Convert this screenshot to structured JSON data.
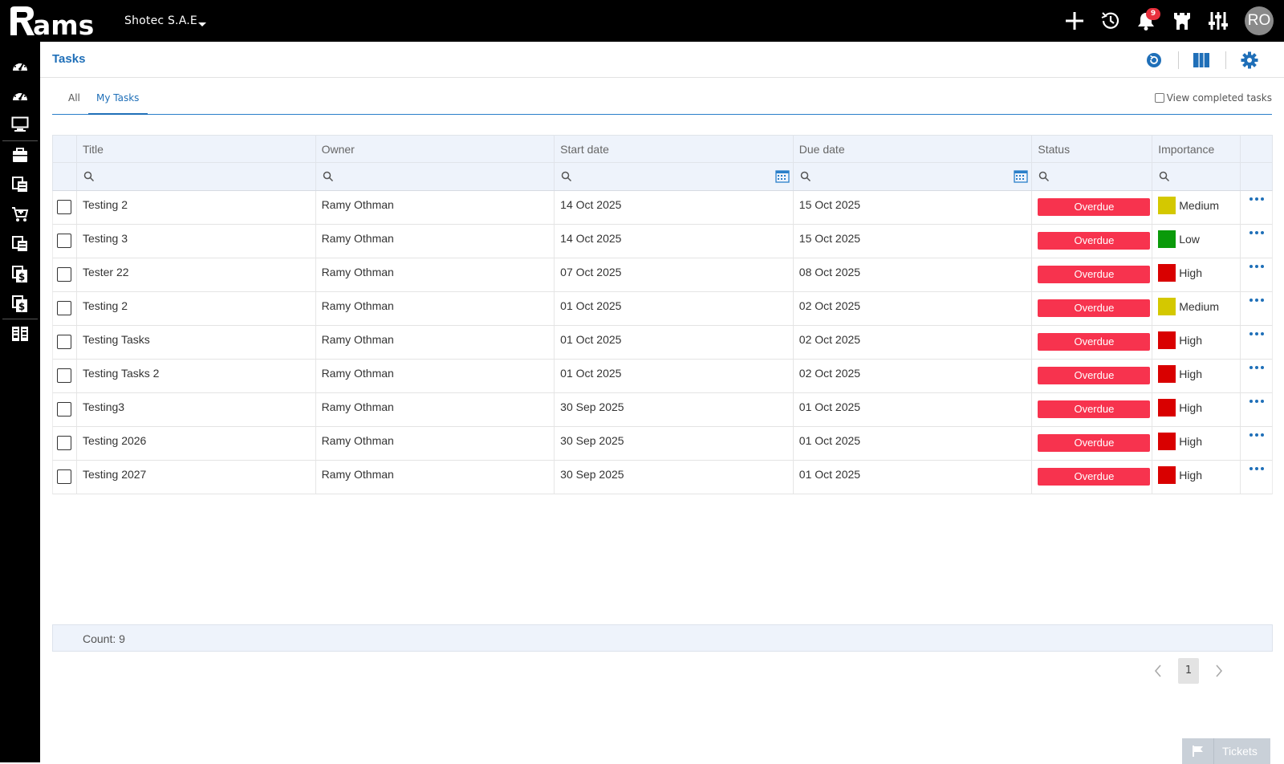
{
  "app": {
    "logo_text": "ams",
    "company": "Shotec S.A.E",
    "notifications_count": "9",
    "user_initials": "RO"
  },
  "topbar_icons": [
    "plus-icon",
    "history-icon",
    "bell-icon",
    "castle-icon",
    "sliders-icon"
  ],
  "sidebar_icons": [
    "dashboard-icon",
    "dashboard-2-icon",
    "monitor-icon",
    "briefcase-icon",
    "documents-icon",
    "cart-icon",
    "documents-2-icon",
    "invoice-icon",
    "invoice-2-icon",
    "columns-icon"
  ],
  "page": {
    "title": "Tasks"
  },
  "tabs": [
    {
      "label": "All",
      "active": false
    },
    {
      "label": "My Tasks",
      "active": true
    }
  ],
  "view_completed_label": "View completed tasks",
  "columns": {
    "title": "Title",
    "owner": "Owner",
    "start": "Start date",
    "due": "Due date",
    "status": "Status",
    "importance": "Importance"
  },
  "importance_colors": {
    "Medium": "#d4c800",
    "Low": "#0a9a0a",
    "High": "#d90000"
  },
  "status_color": "#f7334e",
  "rows": [
    {
      "title": "Testing 2",
      "owner": "Ramy Othman",
      "start": "14 Oct 2025",
      "due": "15 Oct 2025",
      "status": "Overdue",
      "importance": "Medium"
    },
    {
      "title": "Testing 3",
      "owner": "Ramy Othman",
      "start": "14 Oct 2025",
      "due": "15 Oct 2025",
      "status": "Overdue",
      "importance": "Low"
    },
    {
      "title": "Tester 22",
      "owner": "Ramy Othman",
      "start": "07 Oct 2025",
      "due": "08 Oct 2025",
      "status": "Overdue",
      "importance": "High"
    },
    {
      "title": "Testing 2",
      "owner": "Ramy Othman",
      "start": "01 Oct 2025",
      "due": "02 Oct 2025",
      "status": "Overdue",
      "importance": "Medium"
    },
    {
      "title": "Testing Tasks",
      "owner": "Ramy Othman",
      "start": "01 Oct 2025",
      "due": "02 Oct 2025",
      "status": "Overdue",
      "importance": "High"
    },
    {
      "title": "Testing Tasks 2",
      "owner": "Ramy Othman",
      "start": "01 Oct 2025",
      "due": "02 Oct 2025",
      "status": "Overdue",
      "importance": "High"
    },
    {
      "title": "Testing3",
      "owner": "Ramy Othman",
      "start": "30 Sep 2025",
      "due": "01 Oct 2025",
      "status": "Overdue",
      "importance": "High"
    },
    {
      "title": "Testing 2026",
      "owner": "Ramy Othman",
      "start": "30 Sep 2025",
      "due": "01 Oct 2025",
      "status": "Overdue",
      "importance": "High"
    },
    {
      "title": "Testing 2027",
      "owner": "Ramy Othman",
      "start": "30 Sep 2025",
      "due": "01 Oct 2025",
      "status": "Overdue",
      "importance": "High"
    }
  ],
  "footer": {
    "count_label": "Count: 9"
  },
  "pager": {
    "current_page": "1"
  },
  "tickets_label": "Tickets"
}
